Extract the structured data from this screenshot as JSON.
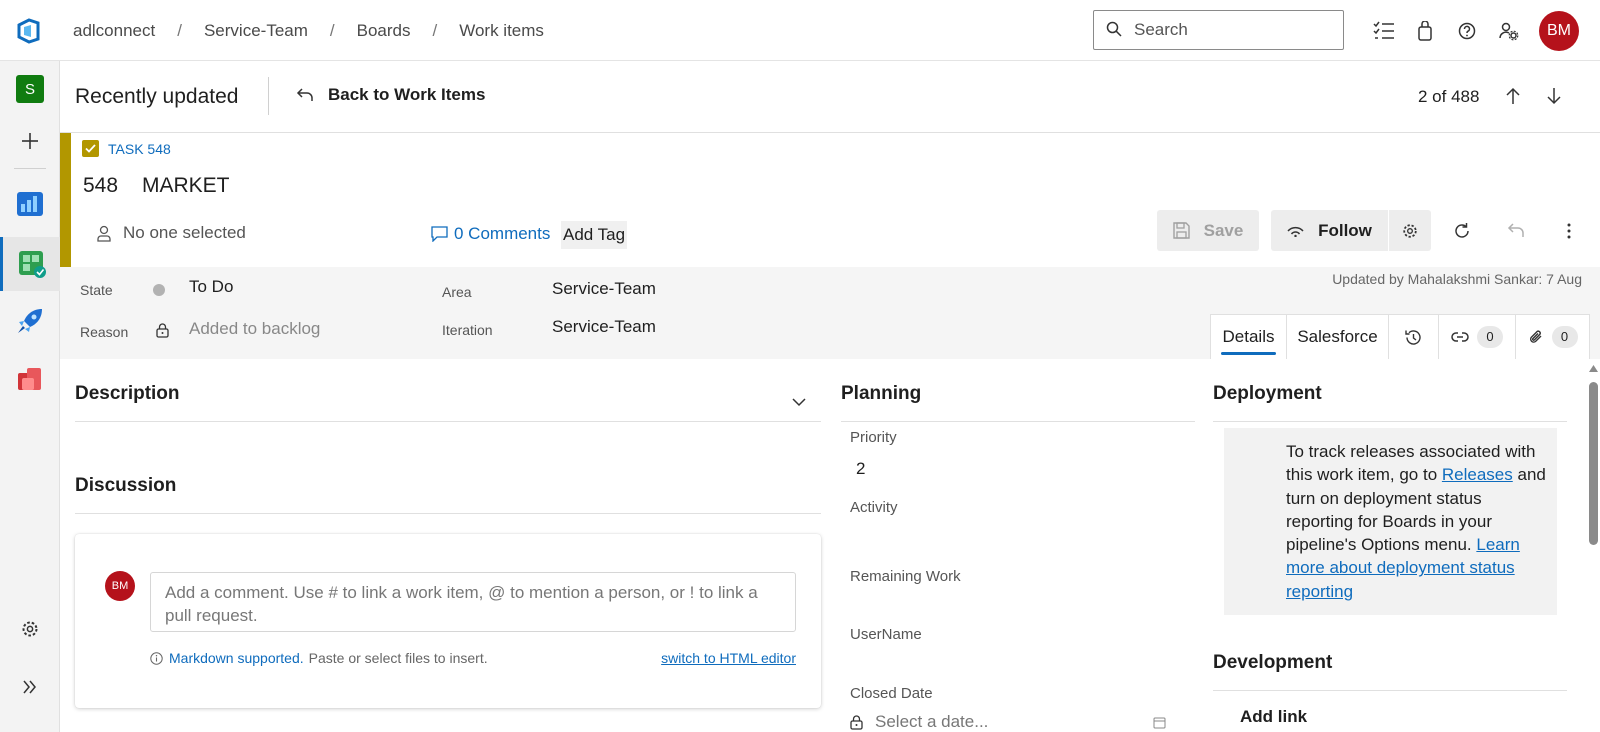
{
  "breadcrumbs": [
    "adlconnect",
    "Service-Team",
    "Boards",
    "Work items"
  ],
  "search": {
    "placeholder": "Search"
  },
  "user": {
    "initials": "BM"
  },
  "rail": {
    "project_initial": "S"
  },
  "header": {
    "title": "Recently updated",
    "back_label": "Back to Work Items",
    "pager": "2 of 488"
  },
  "work_item": {
    "type_label": "TASK 548",
    "id": "548",
    "title": "MARKET",
    "assignee": "No one selected",
    "comments_label": "0 Comments",
    "add_tag_label": "Add Tag",
    "save_label": "Save",
    "follow_label": "Follow",
    "type_color": "#b29700"
  },
  "fields": {
    "state_label": "State",
    "state_value": "To Do",
    "reason_label": "Reason",
    "reason_value": "Added to backlog",
    "area_label": "Area",
    "area_value": "Service-Team",
    "iteration_label": "Iteration",
    "iteration_value": "Service-Team",
    "updated": "Updated by Mahalakshmi Sankar: 7 Aug"
  },
  "tabs": {
    "details": "Details",
    "salesforce": "Salesforce",
    "links_count": "0",
    "attachments_count": "0"
  },
  "description": {
    "title": "Description"
  },
  "discussion": {
    "title": "Discussion",
    "avatar": "BM",
    "placeholder": "Add a comment. Use # to link a work item, @ to mention a person, or ! to link a pull request.",
    "markdown_label": "Markdown supported.",
    "paste_hint": "Paste or select files to insert.",
    "switch_label": "switch to HTML editor"
  },
  "planning": {
    "title": "Planning",
    "priority_label": "Priority",
    "priority_value": "2",
    "activity_label": "Activity",
    "remaining_label": "Remaining Work",
    "username_label": "UserName",
    "closed_label": "Closed Date",
    "closed_placeholder": "Select a date..."
  },
  "deployment": {
    "title": "Deployment",
    "text_1": "To track releases associated with this work item, go to ",
    "releases_link": "Releases",
    "text_2": " and turn on deployment status reporting for Boards in your pipeline's Options menu. ",
    "learn_link": "Learn more about deployment status reporting"
  },
  "development": {
    "title": "Development",
    "add_link": "Add link"
  },
  "colors": {
    "accent": "#0f6cbd",
    "avatar": "#b5121b",
    "project": "#107c10"
  }
}
